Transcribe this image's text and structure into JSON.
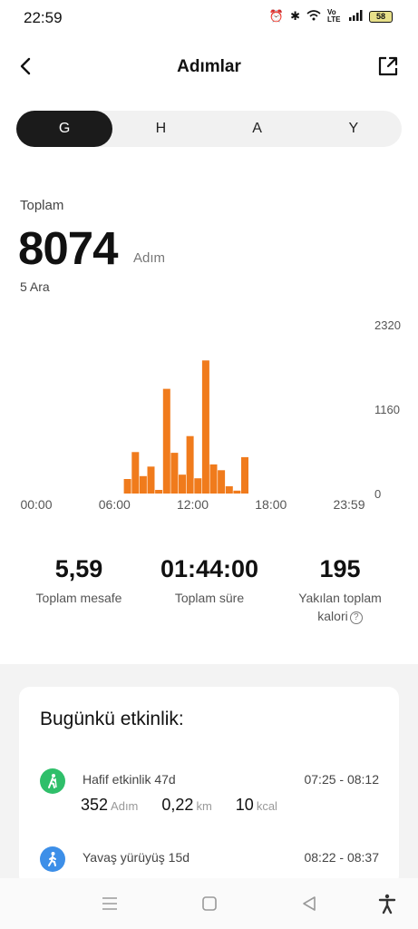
{
  "status": {
    "time": "22:59",
    "battery": "58",
    "network": "Vo LTE"
  },
  "header": {
    "title": "Adımlar"
  },
  "tabs": [
    {
      "label": "G",
      "active": true
    },
    {
      "label": "H",
      "active": false
    },
    {
      "label": "A",
      "active": false
    },
    {
      "label": "Y",
      "active": false
    }
  ],
  "summary": {
    "label": "Toplam",
    "value": "8074",
    "unit": "Adım",
    "date": "5 Ara"
  },
  "chart_data": {
    "type": "bar",
    "color": "#f07b1c",
    "x_ticks": [
      "00:00",
      "06:00",
      "12:00",
      "18:00",
      "23:59"
    ],
    "y_ticks": [
      "2320",
      "1160",
      "0"
    ],
    "ylim": [
      0,
      2320
    ],
    "grid": false,
    "bars": [
      {
        "hour": 7.0,
        "value": 200
      },
      {
        "hour": 7.6,
        "value": 570
      },
      {
        "hour": 8.2,
        "value": 240
      },
      {
        "hour": 8.8,
        "value": 370
      },
      {
        "hour": 9.4,
        "value": 50
      },
      {
        "hour": 10.0,
        "value": 1440
      },
      {
        "hour": 10.6,
        "value": 560
      },
      {
        "hour": 11.2,
        "value": 260
      },
      {
        "hour": 11.8,
        "value": 790
      },
      {
        "hour": 12.4,
        "value": 210
      },
      {
        "hour": 13.0,
        "value": 1830
      },
      {
        "hour": 13.6,
        "value": 400
      },
      {
        "hour": 14.2,
        "value": 320
      },
      {
        "hour": 14.8,
        "value": 100
      },
      {
        "hour": 15.4,
        "value": 40
      },
      {
        "hour": 16.0,
        "value": 500
      }
    ]
  },
  "stats": [
    {
      "value": "5,59",
      "label": "Toplam mesafe"
    },
    {
      "value": "01:44:00",
      "label": "Toplam süre"
    },
    {
      "value": "195",
      "label_line1": "Yakılan toplam",
      "label_line2": "kalori"
    }
  ],
  "activity": {
    "title": "Bugünkü etkinlik:",
    "items": [
      {
        "name": "Hafif etkinlik 47d",
        "time": "07:25 - 08:12",
        "icon": "hiker-icon",
        "color": "#2fbf6a",
        "steps": "352",
        "steps_unit": "Adım",
        "distance": "0,22",
        "distance_unit": "km",
        "kcal": "10",
        "kcal_unit": "kcal"
      },
      {
        "name": "Yavaş yürüyüş 15d",
        "time": "08:22 - 08:37",
        "icon": "walker-icon",
        "color": "#3d8fe8"
      }
    ]
  }
}
